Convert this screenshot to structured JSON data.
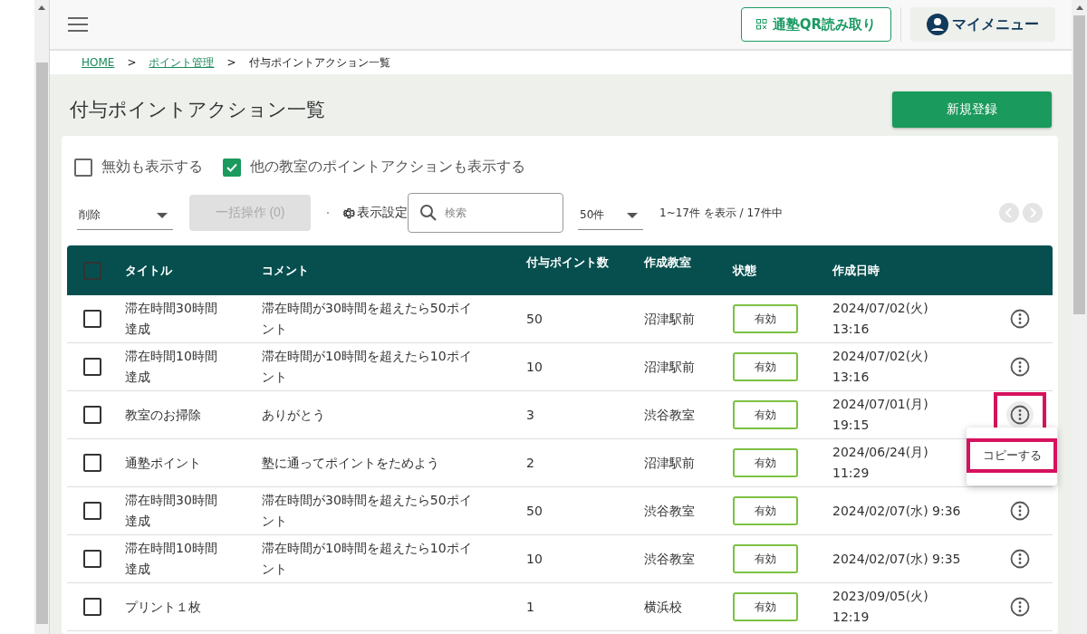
{
  "header": {
    "qr_button": "通塾QR読み取り",
    "my_menu": "マイメニュー"
  },
  "breadcrumb": [
    {
      "label": "HOME",
      "link": true
    },
    {
      "label": "ポイント管理",
      "link": true
    },
    {
      "label": "付与ポイントアクション一覧",
      "link": false
    }
  ],
  "breadcrumb_separator": ">",
  "page_title": "付与ポイントアクション一覧",
  "new_button": "新規登録",
  "filters": [
    {
      "label": "無効も表示する",
      "checked": false
    },
    {
      "label": "他の教室のポイントアクションも表示する",
      "checked": true
    }
  ],
  "bulk_select": {
    "value": "削除"
  },
  "bulk_button": {
    "label": "一括操作 (0)",
    "disabled": true
  },
  "display_settings": "表示設定",
  "search": {
    "placeholder": "検索"
  },
  "per_page": {
    "value": "50件"
  },
  "range_text": "1~17件 を表示 / 17件中",
  "table": {
    "columns": [
      "タイトル",
      "コメント",
      "付与ポイント数",
      "作成教室",
      "状態",
      "作成日時"
    ],
    "select_all_checked": false,
    "rows": [
      {
        "checked": false,
        "title": "滞在時間30時間達成",
        "comment": "滞在時間が30時間を超えたら50ポイント",
        "points": "50",
        "classroom": "沼津駅前",
        "status": "有効",
        "date": "2024/07/02(火)\n13:16",
        "menu_open": false
      },
      {
        "checked": false,
        "title": "滞在時間10時間達成",
        "comment": "滞在時間が10時間を超えたら10ポイント",
        "points": "10",
        "classroom": "沼津駅前",
        "status": "有効",
        "date": "2024/07/02(火)\n13:16",
        "menu_open": false
      },
      {
        "checked": false,
        "title": "教室のお掃除",
        "comment": "ありがとう",
        "points": "3",
        "classroom": "渋谷教室",
        "status": "有効",
        "date": "2024/07/01(月)\n19:15",
        "menu_open": true
      },
      {
        "checked": false,
        "title": "通塾ポイント",
        "comment": "塾に通ってポイントをためよう",
        "points": "2",
        "classroom": "沼津駅前",
        "status": "有効",
        "date": "2024/06/24(月)\n11:29",
        "menu_open": false
      },
      {
        "checked": false,
        "title": "滞在時間30時間達成",
        "comment": "滞在時間が30時間を超えたら50ポイント",
        "points": "50",
        "classroom": "渋谷教室",
        "status": "有効",
        "date": "2024/02/07(水) 9:36",
        "menu_open": false
      },
      {
        "checked": false,
        "title": "滞在時間10時間達成",
        "comment": "滞在時間が10時間を超えたら10ポイント",
        "points": "10",
        "classroom": "渋谷教室",
        "status": "有効",
        "date": "2024/02/07(水) 9:35",
        "menu_open": false
      },
      {
        "checked": false,
        "title": "プリント１枚",
        "comment": "",
        "points": "1",
        "classroom": "横浜校",
        "status": "有効",
        "date": "2023/09/05(火)\n12:19",
        "menu_open": false
      }
    ]
  },
  "row_menu": {
    "items": [
      {
        "label": "コピーする",
        "highlighted": true
      }
    ]
  }
}
